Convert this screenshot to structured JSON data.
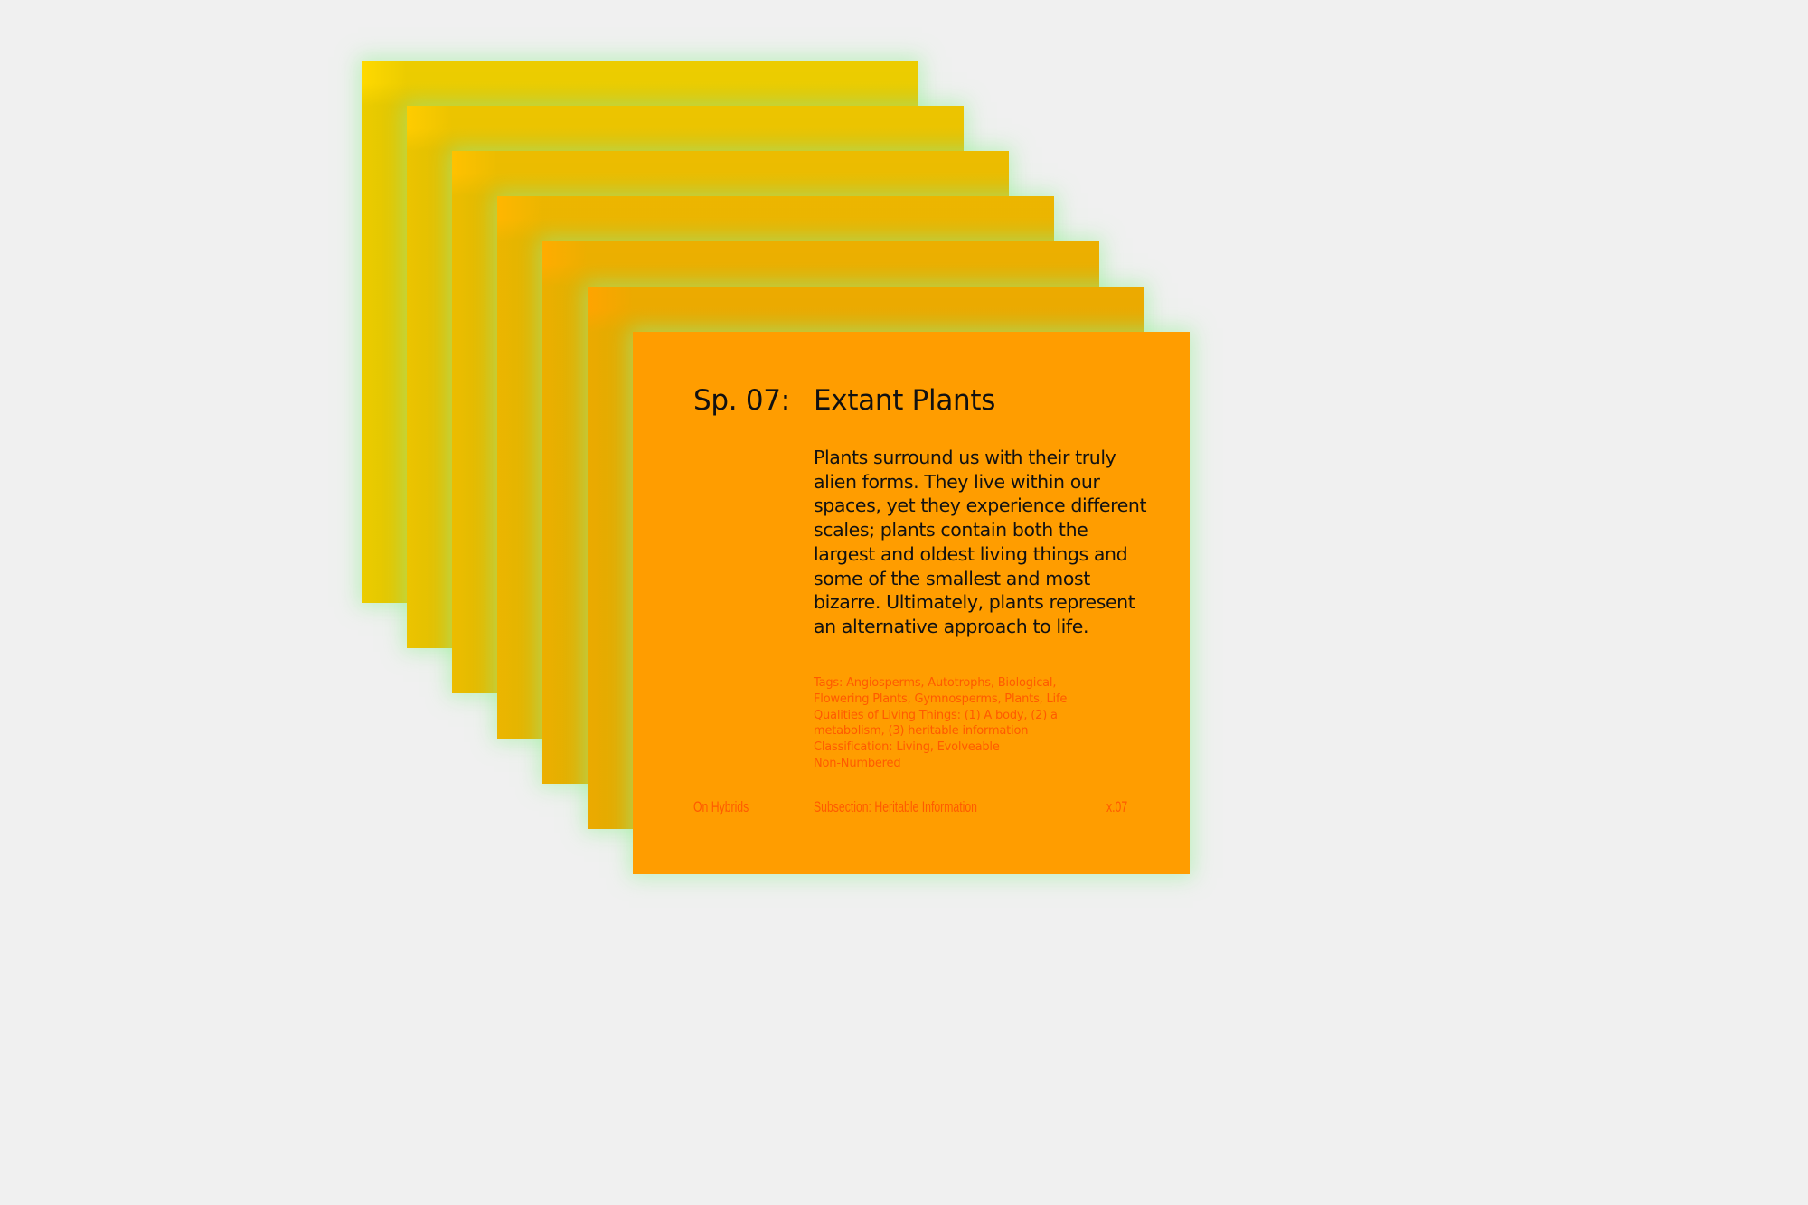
{
  "cards_stack": {
    "colors": [
      "#ffd900",
      "#ffcc00",
      "#ffc100",
      "#ffb600",
      "#ffac00",
      "#ffa400",
      "#ff9d00"
    ],
    "glow_color": "#96f096"
  },
  "card": {
    "species_label": "Sp. 07:",
    "title": "Extant Plants",
    "description": "Plants surround us with their truly alien forms. They live within our spaces, yet they experience different scales; plants contain both the largest and oldest living things and some of the smallest and most bizarre. Ultimately, plants represent an alternative approach to life.",
    "meta_lines": [
      "Tags: Angiosperms, Autotrophs, Biological,",
      "Flowering Plants, Gymnosperms, Plants, Life",
      "Qualities of Living Things: (1) A body, (2) a",
      "metabolism, (3) heritable information",
      "Classification: Living, Evolveable",
      "Non-Numbered"
    ],
    "footer": {
      "section": "On Hybrids",
      "subsection": "Subsection: Heritable Information",
      "index": "x.07"
    },
    "meta_color": "#ff5a00"
  }
}
